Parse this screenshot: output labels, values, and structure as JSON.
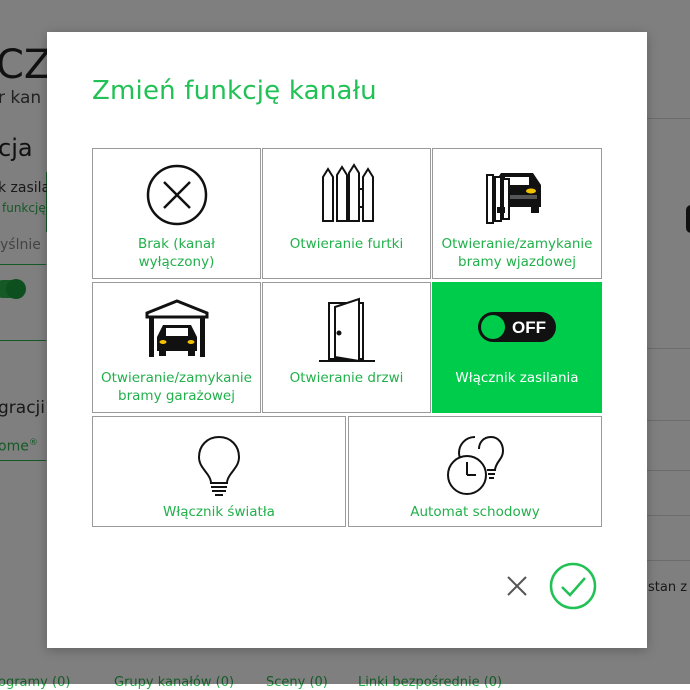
{
  "background": {
    "heading_fragment": "CZI",
    "subheading_fragment": "r kan",
    "section_fragment": "cja",
    "field1_fragment": "k zasilar",
    "field1_link_fragment": "funkcję",
    "field2_fragment": "yślnie",
    "integration_fragment": "gracji",
    "brand_fragment": "ome",
    "brand_mark": "®",
    "right_fragment": "stan z in",
    "footer_links": [
      "ogramy (0)",
      "Grupy kanałów (0)",
      "Sceny (0)",
      "Linki bezpośrednie (0)"
    ]
  },
  "modal": {
    "title": "Zmień funkcję kanału",
    "options": [
      {
        "label": "Brak (kanał wyłączony)",
        "icon": "circle-x-icon",
        "selected": false
      },
      {
        "label": "Otwieranie furtki",
        "icon": "gate-icon",
        "selected": false
      },
      {
        "label": "Otwieranie/zamykanie bramy wjazdowej",
        "icon": "driveway-gate-car-icon",
        "selected": false
      },
      {
        "label": "Otwieranie/zamykanie bramy garażowej",
        "icon": "garage-car-icon",
        "selected": false
      },
      {
        "label": "Otwieranie drzwi",
        "icon": "door-icon",
        "selected": false
      },
      {
        "label": "Włącznik zasilania",
        "icon": "power-toggle-icon",
        "toggle_text": "OFF",
        "selected": true
      },
      {
        "label": "Włącznik światła",
        "icon": "light-bulb-icon",
        "selected": false
      },
      {
        "label": "Automat schodowy",
        "icon": "staircase-timer-icon",
        "selected": false
      }
    ],
    "cancel_icon": "close-icon",
    "confirm_icon": "checkmark-circle-icon"
  },
  "colors": {
    "accent": "#22c155",
    "selected_bg": "#00cc4b",
    "overlay": "rgba(0,0,0,0.5)"
  }
}
